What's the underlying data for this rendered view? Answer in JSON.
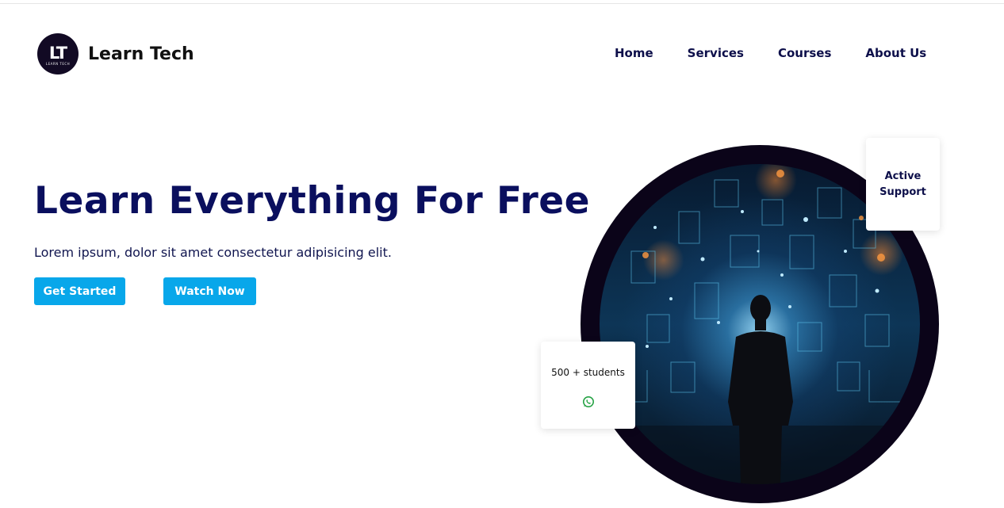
{
  "brand": {
    "logo_initials": "LT",
    "logo_subtext": "LEARN TECH",
    "name": "Learn Tech"
  },
  "nav": {
    "items": [
      {
        "label": "Home"
      },
      {
        "label": "Services"
      },
      {
        "label": "Courses"
      },
      {
        "label": "About Us"
      }
    ]
  },
  "hero": {
    "title": "Learn Everything For Free",
    "subtitle": "Lorem ipsum, dolor sit amet consectetur adipisicing elit.",
    "buttons": {
      "get_started": "Get Started",
      "watch_now": "Watch Now"
    }
  },
  "cards": {
    "support": {
      "line1": "Active",
      "line2": "Support"
    },
    "students": {
      "text": "500 + students",
      "icon": "whatsapp-icon"
    }
  },
  "colors": {
    "accent": "#08a7ea",
    "heading": "#0a0f5e",
    "dark_frame": "#0b0419",
    "whatsapp": "#25a244"
  }
}
